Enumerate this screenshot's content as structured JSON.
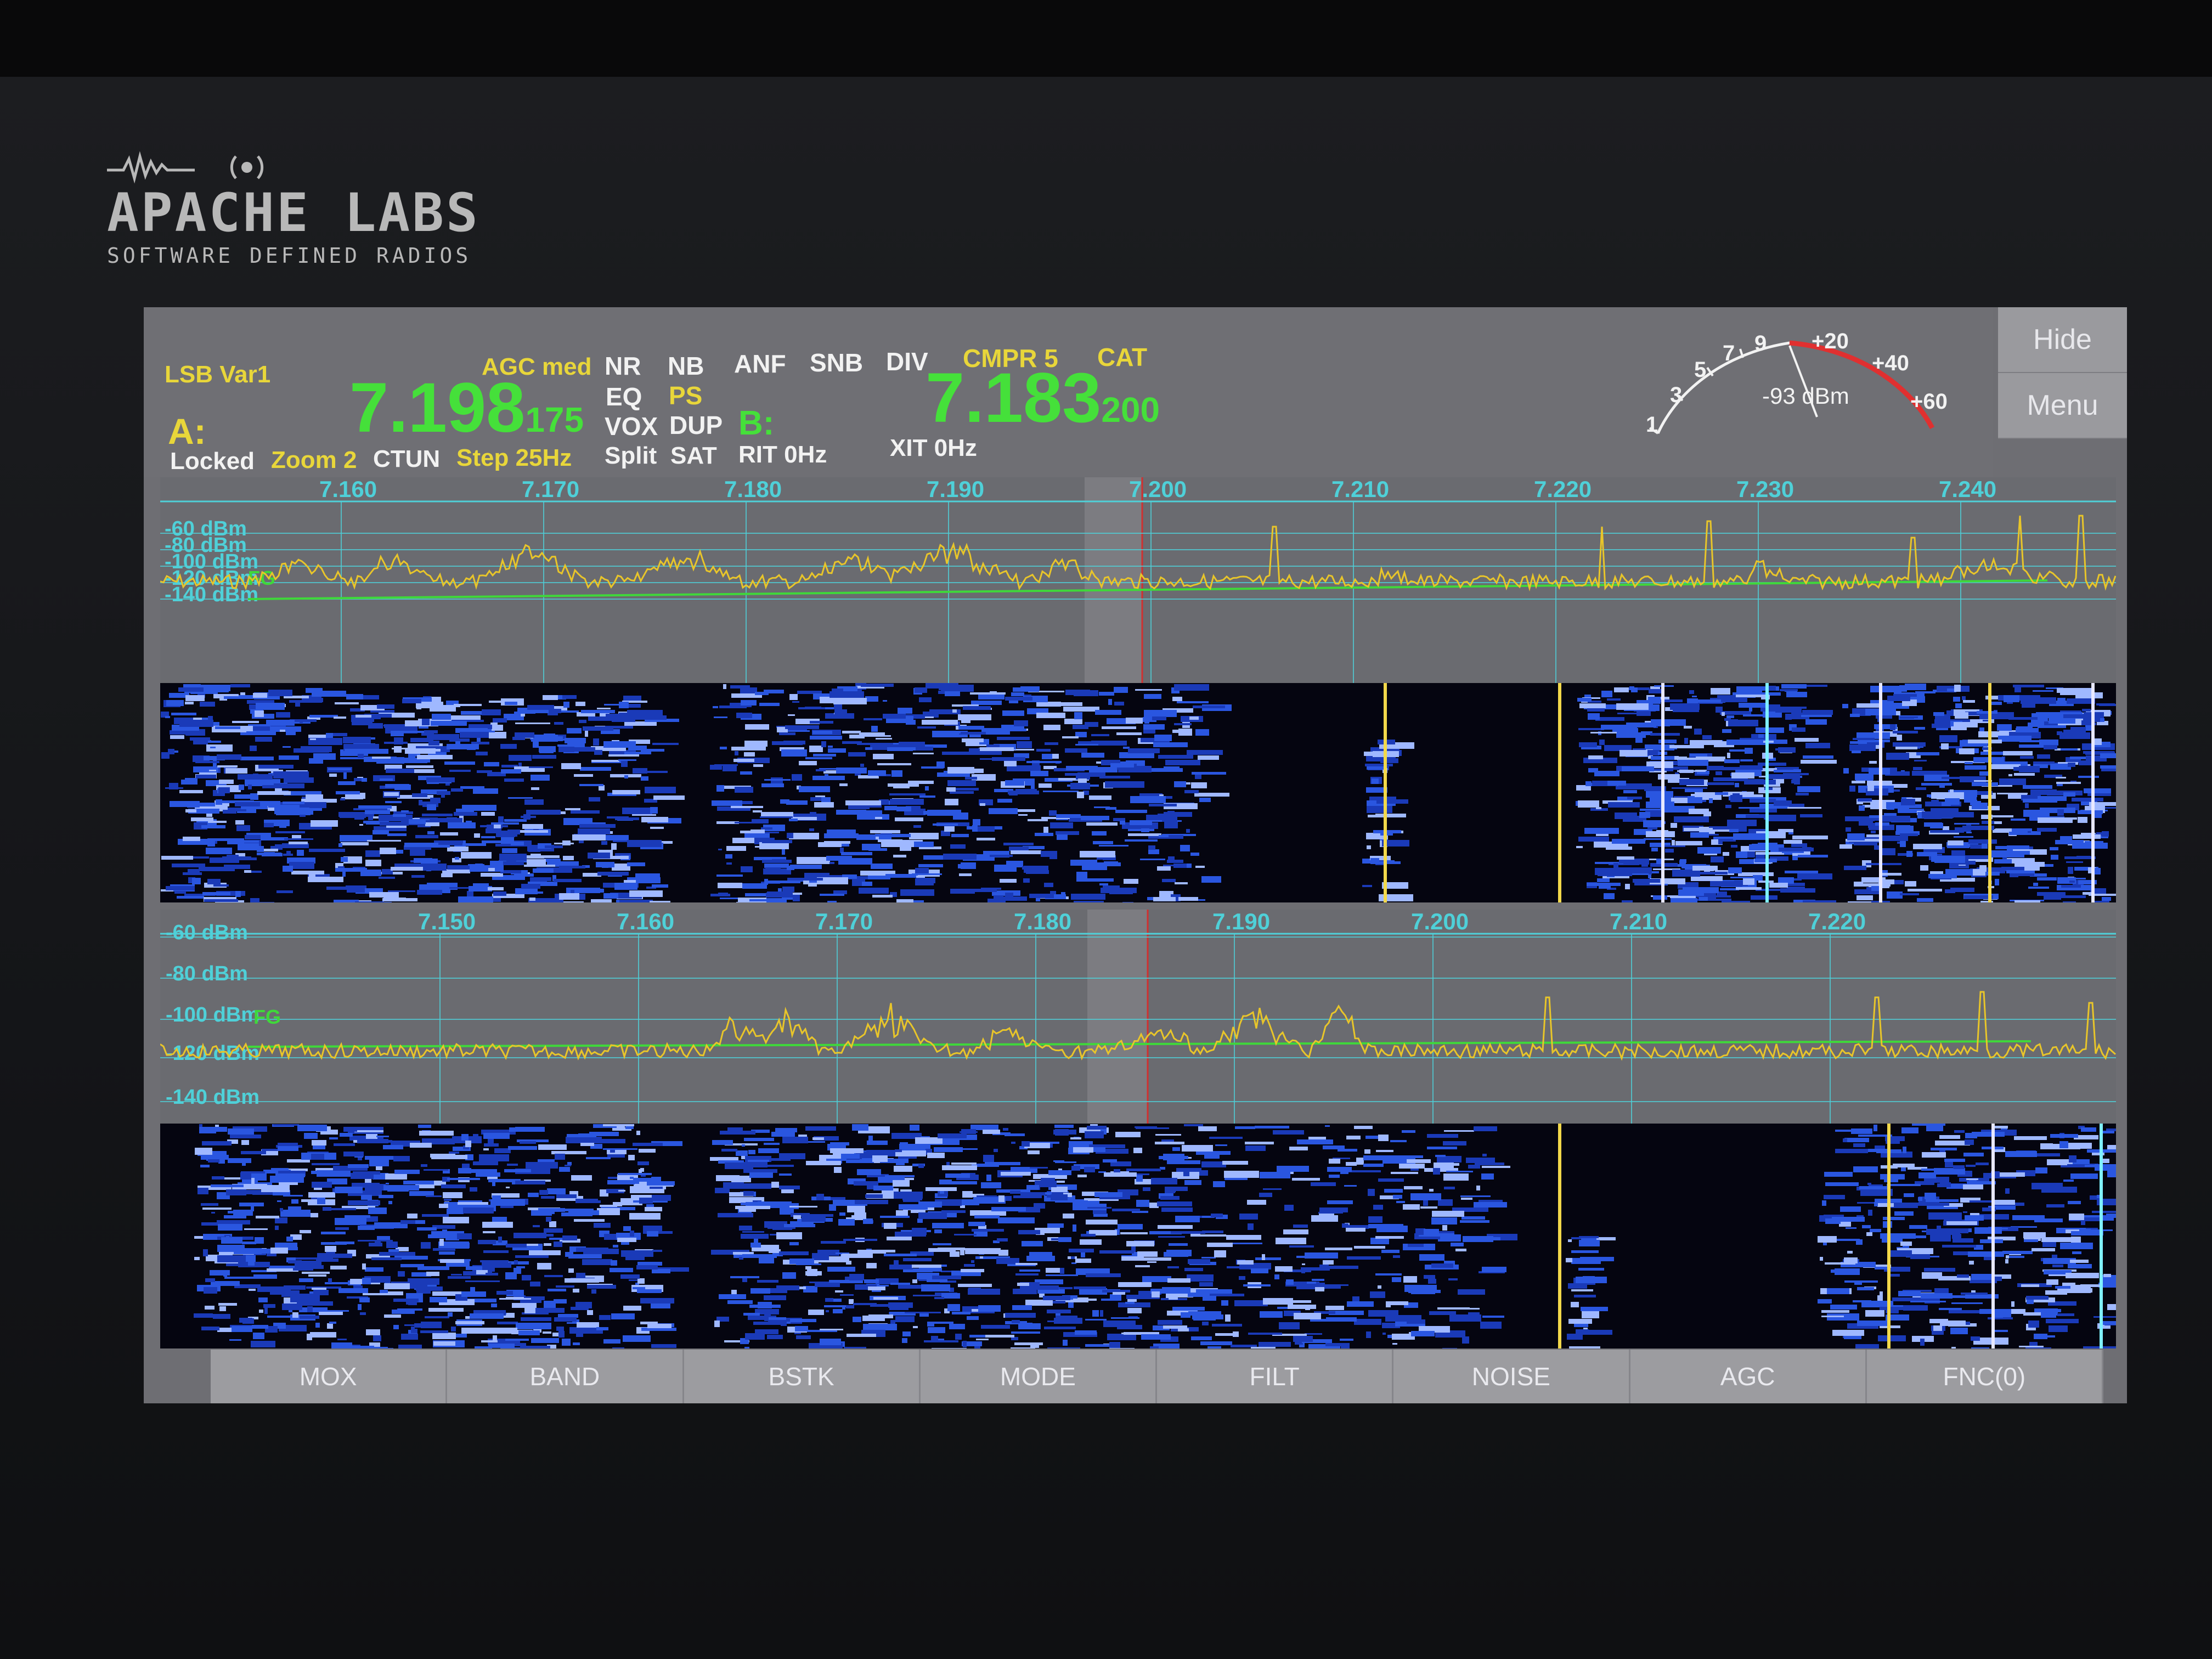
{
  "device": {
    "brand": "APACHE LABS",
    "tagline": "SOFTWARE DEFINED RADIOS"
  },
  "menu": {
    "hide_label": "Hide",
    "menu_label": "Menu"
  },
  "vfo_a": {
    "mode": "LSB Var1",
    "label": "A:",
    "freq_main": "7.198",
    "freq_sub": "175",
    "agc": "AGC med",
    "locked": "Locked",
    "zoom": "Zoom 2",
    "ctun": "CTUN",
    "step": "Step 25Hz"
  },
  "flags": {
    "nr": "NR",
    "nb": "NB",
    "anf": "ANF",
    "snb": "SNB",
    "div": "DIV",
    "cmpr": "CMPR 5",
    "cat": "CAT",
    "eq": "EQ",
    "ps": "PS",
    "vox": "VOX",
    "dup": "DUP",
    "split": "Split",
    "sat": "SAT",
    "rit": "RIT 0Hz",
    "xit": "XIT 0Hz"
  },
  "vfo_b": {
    "label": "B:",
    "freq_main": "7.183",
    "freq_sub": "200"
  },
  "meter": {
    "reading": "-93 dBm",
    "scale": [
      "1",
      "3",
      "5",
      "7",
      "9",
      "+20",
      "+40",
      "+60"
    ]
  },
  "panadapter1": {
    "freq_ticks": [
      "7.160",
      "7.170",
      "7.180",
      "7.190",
      "7.200",
      "7.210",
      "7.220",
      "7.230",
      "7.240"
    ],
    "db_ticks": [
      "-60 dBm",
      "-80 dBm",
      "-100 dBm",
      "-120 dBm",
      "-140 dBm"
    ],
    "marker": "FG"
  },
  "panadapter2": {
    "freq_ticks": [
      "7.150",
      "7.160",
      "7.170",
      "7.180",
      "7.190",
      "7.200",
      "7.210",
      "7.220"
    ],
    "db_ticks": [
      "-60 dBm",
      "-80 dBm",
      "-100 dBm",
      "-120 dBm",
      "-140 dBm"
    ],
    "marker": "FG"
  },
  "toolbar": [
    "MOX",
    "BAND",
    "BSTK",
    "MODE",
    "FILT",
    "NOISE",
    "AGC",
    "FNC(0)"
  ],
  "colors": {
    "spectrum": "#e8c52a",
    "grid": "#4fd0d8",
    "freq_green": "#45e03a",
    "label_yellow": "#e8d63a",
    "waterfall_blue": "#2a56e0"
  }
}
